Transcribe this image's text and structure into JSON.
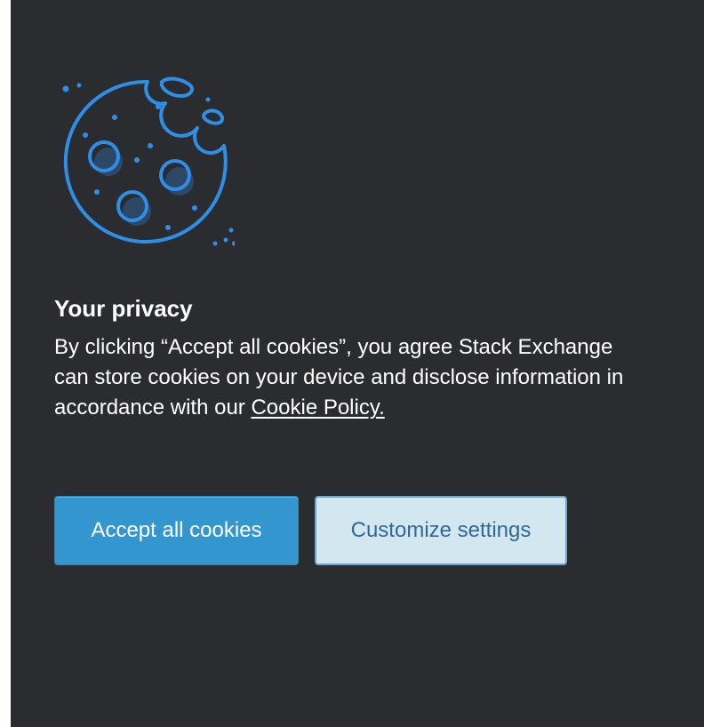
{
  "banner": {
    "title": "Your privacy",
    "message_text": "By clicking “Accept all cookies”, you agree Stack Exchange can store cookies on your device and disclose information in accordance with our ",
    "policy_link_label": "Cookie Policy.",
    "accept_label": "Accept all cookies",
    "customize_label": "Customize settings"
  },
  "illustration": {
    "icon": "cookie-icon",
    "stroke_color": "#2f8ee6",
    "fill_color": "#2c4866"
  },
  "colors": {
    "panel_background": "#2a2c2f",
    "accept_button": "#3496cf",
    "customize_button": "#d3e7f1",
    "customize_text": "#2f6a93"
  }
}
